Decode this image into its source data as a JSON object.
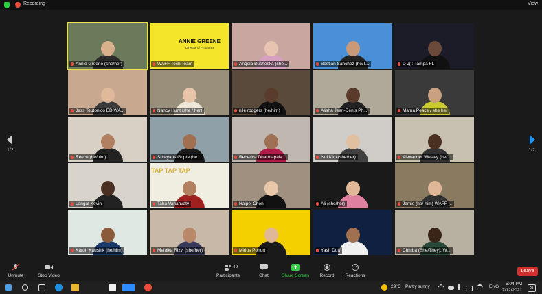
{
  "topbar": {
    "recording_label": "Recording",
    "view_label": "View"
  },
  "pager": {
    "left": "1/2",
    "right": "1/2"
  },
  "tiles": [
    {
      "name": "Annie Greene (she/her)",
      "bg": "#6b7a5a",
      "skin": "#d9b08c",
      "shirt": "#2a2a2a",
      "active": true
    },
    {
      "name": "WAFF Tech Team",
      "bg": "#f5e52a",
      "slide_title": "ANNIE GREENE",
      "slide_sub": "Director of Programs"
    },
    {
      "name": "Angela Busheska (she...",
      "bg": "#c9a6a0",
      "skin": "#e8c4b0",
      "shirt": "#d7a0c0"
    },
    {
      "name": "Bastian Sanchez (he/T...",
      "bg": "#4a90d9",
      "skin": "#c99a7a",
      "shirt": "#222"
    },
    {
      "name": "D J( : Tampa FL",
      "bg": "#1c1c28",
      "skin": "#6b4a3a",
      "shirt": "#111"
    },
    {
      "name": "Jess Teutonico ED WA...",
      "bg": "#c9a890",
      "skin": "#e0b89a",
      "shirt": "#3a3a3a"
    },
    {
      "name": "Nancy Hunt (she / her)",
      "bg": "#9a8f7a",
      "skin": "#e8c4a8",
      "shirt": "#f0e6d8"
    },
    {
      "name": "nile rodgers (he/him)",
      "bg": "#5a4a3c",
      "skin": "#5a3c2c",
      "shirt": "#111"
    },
    {
      "name": "Alisha Jean-Denis Ph...",
      "bg": "#b0a898",
      "skin": "#5a3a2a",
      "shirt": "#222"
    },
    {
      "name": "Mama Peace / she her",
      "bg": "#3a3a3a",
      "skin": "#c9a080",
      "shirt": "#c9c930"
    },
    {
      "name": "Reece (he/him)",
      "bg": "#d8d0c4",
      "skin": "#b08060",
      "shirt": "#222"
    },
    {
      "name": "Shreyans Gupta (he...",
      "bg": "#8fa0a8",
      "skin": "#a07050",
      "shirt": "#1a1a1a"
    },
    {
      "name": "Rebecca Dharmapala...",
      "bg": "#c0b8b0",
      "skin": "#a07055",
      "shirt": "#b01c4a"
    },
    {
      "name": "Isul Kim (she/her)",
      "bg": "#d0ccc8",
      "skin": "#e0c0a0",
      "shirt": "#404040"
    },
    {
      "name": "Alexander Wesley (he/...",
      "bg": "#c8c0b0",
      "skin": "#4a3020",
      "shirt": "#333"
    },
    {
      "name": "Langat Kevin",
      "bg": "#d8d4cc",
      "skin": "#4a3022",
      "shirt": "#222"
    },
    {
      "name": "Taha Vahanvaty",
      "bg": "#f0eee0",
      "skin": "#b08060",
      "shirt": "#a02020",
      "banner": "TAP  TAP  TAP"
    },
    {
      "name": "Haipei Chen",
      "bg": "#a09080",
      "skin": "#e8c8a8",
      "shirt": "#111"
    },
    {
      "name": "Ali (she/her)",
      "bg": "#1a1a1a",
      "skin": "#e0b898",
      "shirt": "#e080a0"
    },
    {
      "name": "Jamie (he/ him) WAFF ...",
      "bg": "#8a7a60",
      "skin": "#e0b898",
      "shirt": "#303030"
    },
    {
      "name": "Karun Kaushik (he/him)",
      "bg": "#e0e8e4",
      "skin": "#8a5a3a",
      "shirt": "#1a3a6a"
    },
    {
      "name": "Malaika Rizvi (she/her)",
      "bg": "#c8b8a8",
      "skin": "#b88868",
      "shirt": "#3a3a5a"
    },
    {
      "name": "Mirius Ponon",
      "bg": "#f5d000",
      "skin": "#e0b898",
      "shirt": "#1a1a1a"
    },
    {
      "name": "Yash Dutt",
      "bg": "#102040",
      "skin": "#a07050",
      "shirt": "#f0f0f0"
    },
    {
      "name": "Chmba (She/They), W...",
      "bg": "#b8b0a0",
      "skin": "#3a2418",
      "shirt": "#2a4a3a"
    }
  ],
  "toolbar": {
    "unmute": "Unmute",
    "stop_video": "Stop Video",
    "participants": "Participants",
    "participants_count": "49",
    "chat": "Chat",
    "share_screen": "Share Screen",
    "record": "Record",
    "reactions": "Reactions",
    "leave": "Leave"
  },
  "taskbar": {
    "temperature": "29°C",
    "weather": "Partly sunny",
    "language": "ENG",
    "time": "5:04 PM",
    "date": "7/12/2021",
    "notifications": "31"
  }
}
